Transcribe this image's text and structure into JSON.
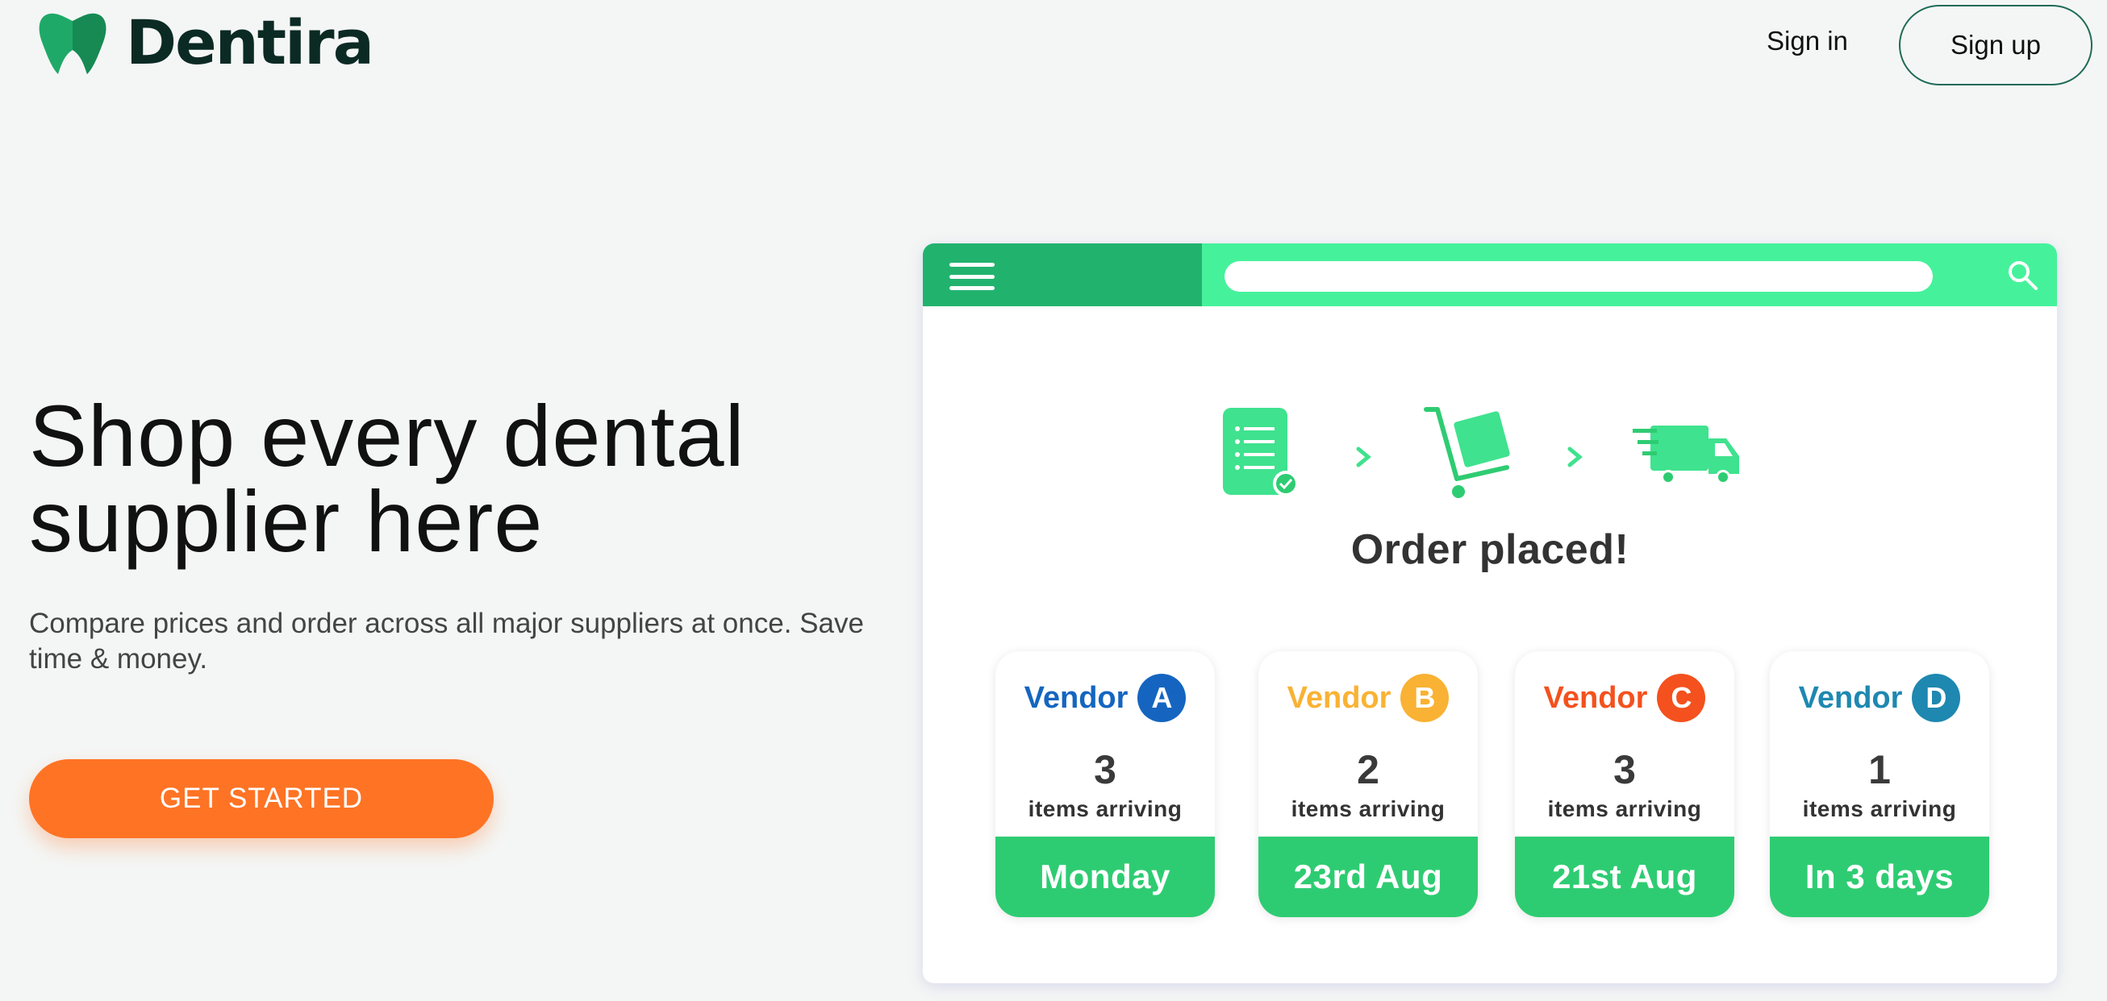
{
  "header": {
    "logo_text": "Dentira",
    "signin_label": "Sign in",
    "signup_label": "Sign up"
  },
  "hero": {
    "title": "Shop every dental supplier here",
    "subtitle": "Compare prices and order across all major suppliers at once. Save time & money.",
    "cta_label": "GET STARTED"
  },
  "mock": {
    "order_title": "Order placed!",
    "steps": [
      "order-list-icon",
      "cart-icon",
      "delivery-truck-icon"
    ],
    "vendors": [
      {
        "name": "Vendor",
        "letter": "A",
        "color": "#1565c0",
        "count": "3",
        "label": "items arriving",
        "arrival": "Monday"
      },
      {
        "name": "Vendor",
        "letter": "B",
        "color": "#f9b233",
        "count": "2",
        "label": "items arriving",
        "arrival": "23rd Aug"
      },
      {
        "name": "Vendor",
        "letter": "C",
        "color": "#f4511e",
        "count": "3",
        "label": "items arriving",
        "arrival": "21st Aug"
      },
      {
        "name": "Vendor",
        "letter": "D",
        "color": "#1e88b0",
        "count": "1",
        "label": "items arriving",
        "arrival": "In 3 days"
      }
    ]
  },
  "colors": {
    "brand_dark": "#0b2a24",
    "brand_green": "#21b36e",
    "accent_green": "#45f29b",
    "cta_orange": "#ff7324"
  }
}
